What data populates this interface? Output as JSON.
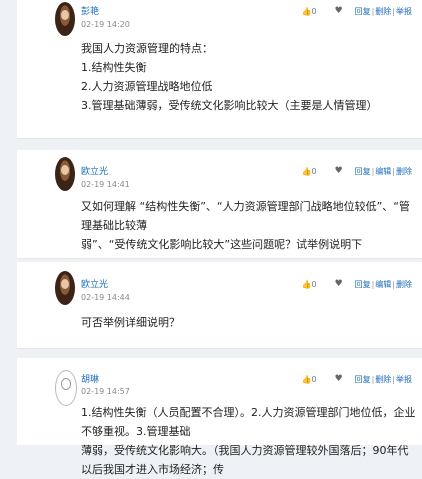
{
  "posts": [
    {
      "user": "彭艳",
      "time": "02-19 14:20",
      "likes": "0",
      "actions": [
        "回复",
        "删除",
        "举报"
      ],
      "body": "我国人力资源管理的特点：\n1.结构性失衡\n2.人力资源管理战略地位低\n3.管理基础薄弱，受传统文化影响比较大（主要是人情管理）"
    },
    {
      "user": "欧立光",
      "time": "02-19 14:41",
      "likes": "0",
      "actions": [
        "回复",
        "编辑",
        "删除"
      ],
      "body": "又如何理解 “结构性失衡”、“人力资源管理部门战略地位较低”、“管理基础比较薄\n弱”、“受传统文化影响比较大”这些问题呢？试举例说明下"
    },
    {
      "user": "欧立光",
      "time": "02-19 14:44",
      "likes": "0",
      "actions": [
        "回复",
        "编辑",
        "删除"
      ],
      "body": "可否举例详细说明？"
    },
    {
      "user": "胡琳",
      "time": "02-19 14:57",
      "likes": "0",
      "actions": [
        "回复",
        "删除",
        "举报"
      ],
      "body": "1.结构性失衡（人员配置不合理）。2.人力资源管理部门地位低，企业不够重视。3.管理基础\n薄弱，受传统文化影响大。（我国人力资源管理较外国落后；90年代以后我国才进入市场经济；传"
    }
  ]
}
